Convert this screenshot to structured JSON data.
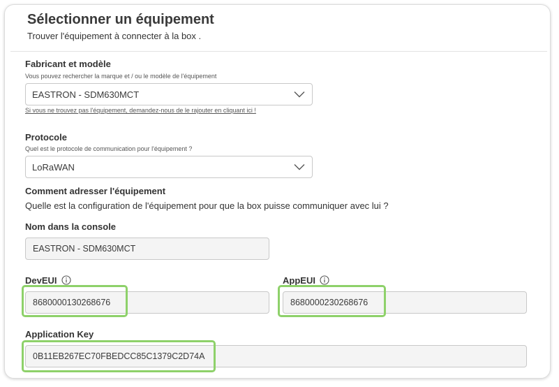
{
  "header": {
    "title": "Sélectionner un équipement",
    "subtitle": "Trouver l'équipement à connecter à la box ."
  },
  "manufacturer": {
    "label": "Fabricant et modèle",
    "hint": "Vous pouvez rechercher la marque et / ou le modèle de l'équipement",
    "value": "EASTRON - SDM630MCT",
    "link": "Si vous ne trouvez pas l'équipement, demandez-nous de le rajouter en cliquant ici !"
  },
  "protocol": {
    "label": "Protocole",
    "hint": "Quel est le protocole de communication pour l'équipement ?",
    "value": "LoRaWAN"
  },
  "addressing": {
    "title": "Comment adresser l'équipement",
    "description": "Quelle est la configuration de l'équipement pour que la box puisse communiquer avec lui ?"
  },
  "console_name": {
    "label": "Nom dans la console",
    "value": "EASTRON - SDM630MCT"
  },
  "dev_eui": {
    "label": "DevEUI",
    "value": "8680000130268676"
  },
  "app_eui": {
    "label": "AppEUI",
    "value": "8680000230268676"
  },
  "app_key": {
    "label": "Application Key",
    "value": "0B11EB267EC70FBEDCC85C1379C2D74A"
  },
  "icons": {
    "dropdown": "chevron-down-icon",
    "info": "info-icon"
  },
  "colors": {
    "highlight": "#8ed16a",
    "field_bg": "#f4f4f4",
    "border": "#c8c8c8"
  }
}
